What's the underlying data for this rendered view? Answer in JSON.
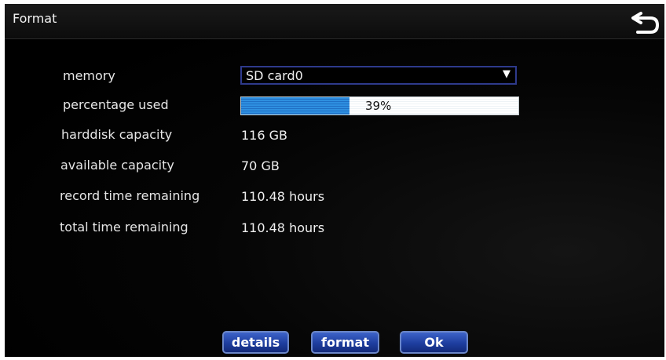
{
  "window": {
    "title": "Format"
  },
  "back_button": {
    "icon": "back-arrow-icon"
  },
  "rows": [
    {
      "label": "memory",
      "type": "select",
      "value": "SD card0"
    },
    {
      "label": "percentage used",
      "type": "progress",
      "percent": 39,
      "text": "39%"
    },
    {
      "label": "harddisk capacity",
      "value": "116 GB"
    },
    {
      "label": "available capacity",
      "value": "70 GB"
    },
    {
      "label": "record time remaining",
      "value": "110.48 hours"
    },
    {
      "label": "total time remaining",
      "value": "110.48 hours"
    }
  ],
  "buttons": {
    "details": "details",
    "format": "format",
    "ok": "Ok"
  },
  "colors": {
    "accent": "#1e3e9f",
    "progress_fill": "#2e8fe0",
    "background": "#000000"
  }
}
